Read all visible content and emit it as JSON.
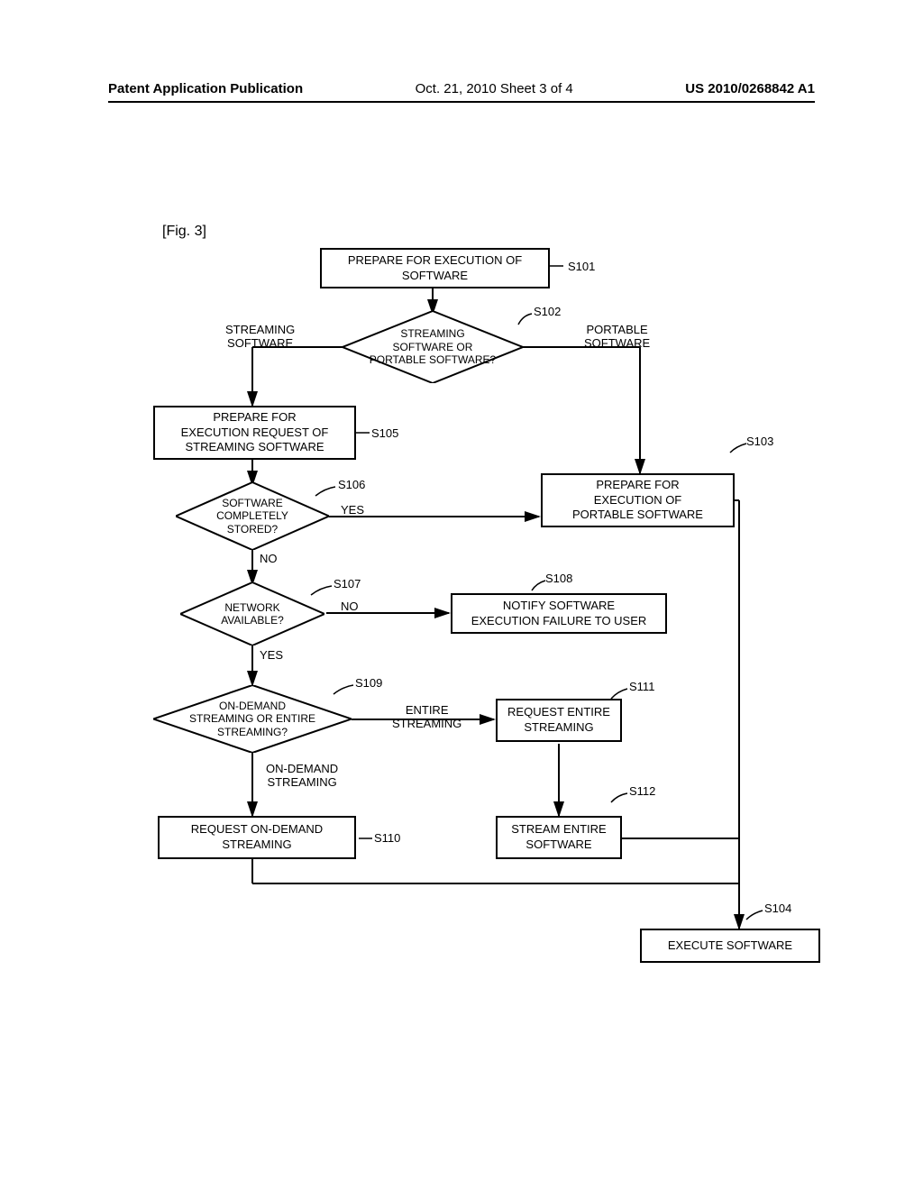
{
  "header": {
    "left": "Patent Application Publication",
    "mid": "Oct. 21, 2010  Sheet 3 of 4",
    "right": "US 2010/0268842 A1"
  },
  "figure_label": "[Fig. 3]",
  "steps": {
    "s101": "S101",
    "s102": "S102",
    "s103": "S103",
    "s104": "S104",
    "s105": "S105",
    "s106": "S106",
    "s107": "S107",
    "s108": "S108",
    "s109": "S109",
    "s110": "S110",
    "s111": "S111",
    "s112": "S112"
  },
  "boxes": {
    "b101": "PREPARE FOR EXECUTION OF\nSOFTWARE",
    "b105": "PREPARE FOR\nEXECUTION REQUEST OF\nSTREAMING SOFTWARE",
    "b103": "PREPARE FOR\nEXECUTION OF\nPORTABLE SOFTWARE",
    "b108": "NOTIFY SOFTWARE\nEXECUTION FAILURE TO USER",
    "b111": "REQUEST ENTIRE\nSTREAMING",
    "b110": "REQUEST ON-DEMAND\nSTREAMING",
    "b112": "STREAM ENTIRE\nSOFTWARE",
    "b104": "EXECUTE SOFTWARE"
  },
  "diamonds": {
    "d102": "STREAMING\nSOFTWARE OR\nPORTABLE SOFTWARE?",
    "d106": "SOFTWARE\nCOMPLETELY\nSTORED?",
    "d107": "NETWORK\nAVAILABLE?",
    "d109": "ON-DEMAND\nSTREAMING OR ENTIRE\nSTREAMING?"
  },
  "labels": {
    "streaming_sw": "STREAMING\nSOFTWARE",
    "portable_sw": "PORTABLE\nSOFTWARE",
    "yes1": "YES",
    "no1": "NO",
    "yes2": "YES",
    "no2": "NO",
    "entire": "ENTIRE\nSTREAMING",
    "ondemand": "ON-DEMAND\nSTREAMING"
  },
  "chart_data": {
    "type": "flowchart",
    "nodes": [
      {
        "id": "S101",
        "type": "process",
        "text": "PREPARE FOR EXECUTION OF SOFTWARE"
      },
      {
        "id": "S102",
        "type": "decision",
        "text": "STREAMING SOFTWARE OR PORTABLE SOFTWARE?"
      },
      {
        "id": "S103",
        "type": "process",
        "text": "PREPARE FOR EXECUTION OF PORTABLE SOFTWARE"
      },
      {
        "id": "S104",
        "type": "process",
        "text": "EXECUTE SOFTWARE"
      },
      {
        "id": "S105",
        "type": "process",
        "text": "PREPARE FOR EXECUTION REQUEST OF STREAMING SOFTWARE"
      },
      {
        "id": "S106",
        "type": "decision",
        "text": "SOFTWARE COMPLETELY STORED?"
      },
      {
        "id": "S107",
        "type": "decision",
        "text": "NETWORK AVAILABLE?"
      },
      {
        "id": "S108",
        "type": "process",
        "text": "NOTIFY SOFTWARE EXECUTION FAILURE TO USER"
      },
      {
        "id": "S109",
        "type": "decision",
        "text": "ON-DEMAND STREAMING OR ENTIRE STREAMING?"
      },
      {
        "id": "S110",
        "type": "process",
        "text": "REQUEST ON-DEMAND STREAMING"
      },
      {
        "id": "S111",
        "type": "process",
        "text": "REQUEST ENTIRE STREAMING"
      },
      {
        "id": "S112",
        "type": "process",
        "text": "STREAM ENTIRE SOFTWARE"
      }
    ],
    "edges": [
      {
        "from": "S101",
        "to": "S102"
      },
      {
        "from": "S102",
        "to": "S105",
        "label": "STREAMING SOFTWARE"
      },
      {
        "from": "S102",
        "to": "S103",
        "label": "PORTABLE SOFTWARE"
      },
      {
        "from": "S103",
        "to": "S104"
      },
      {
        "from": "S105",
        "to": "S106"
      },
      {
        "from": "S106",
        "to": "S103",
        "label": "YES"
      },
      {
        "from": "S106",
        "to": "S107",
        "label": "NO"
      },
      {
        "from": "S107",
        "to": "S108",
        "label": "NO"
      },
      {
        "from": "S107",
        "to": "S109",
        "label": "YES"
      },
      {
        "from": "S109",
        "to": "S111",
        "label": "ENTIRE STREAMING"
      },
      {
        "from": "S109",
        "to": "S110",
        "label": "ON-DEMAND STREAMING"
      },
      {
        "from": "S110",
        "to": "S104"
      },
      {
        "from": "S111",
        "to": "S112"
      },
      {
        "from": "S112",
        "to": "S104"
      }
    ]
  }
}
